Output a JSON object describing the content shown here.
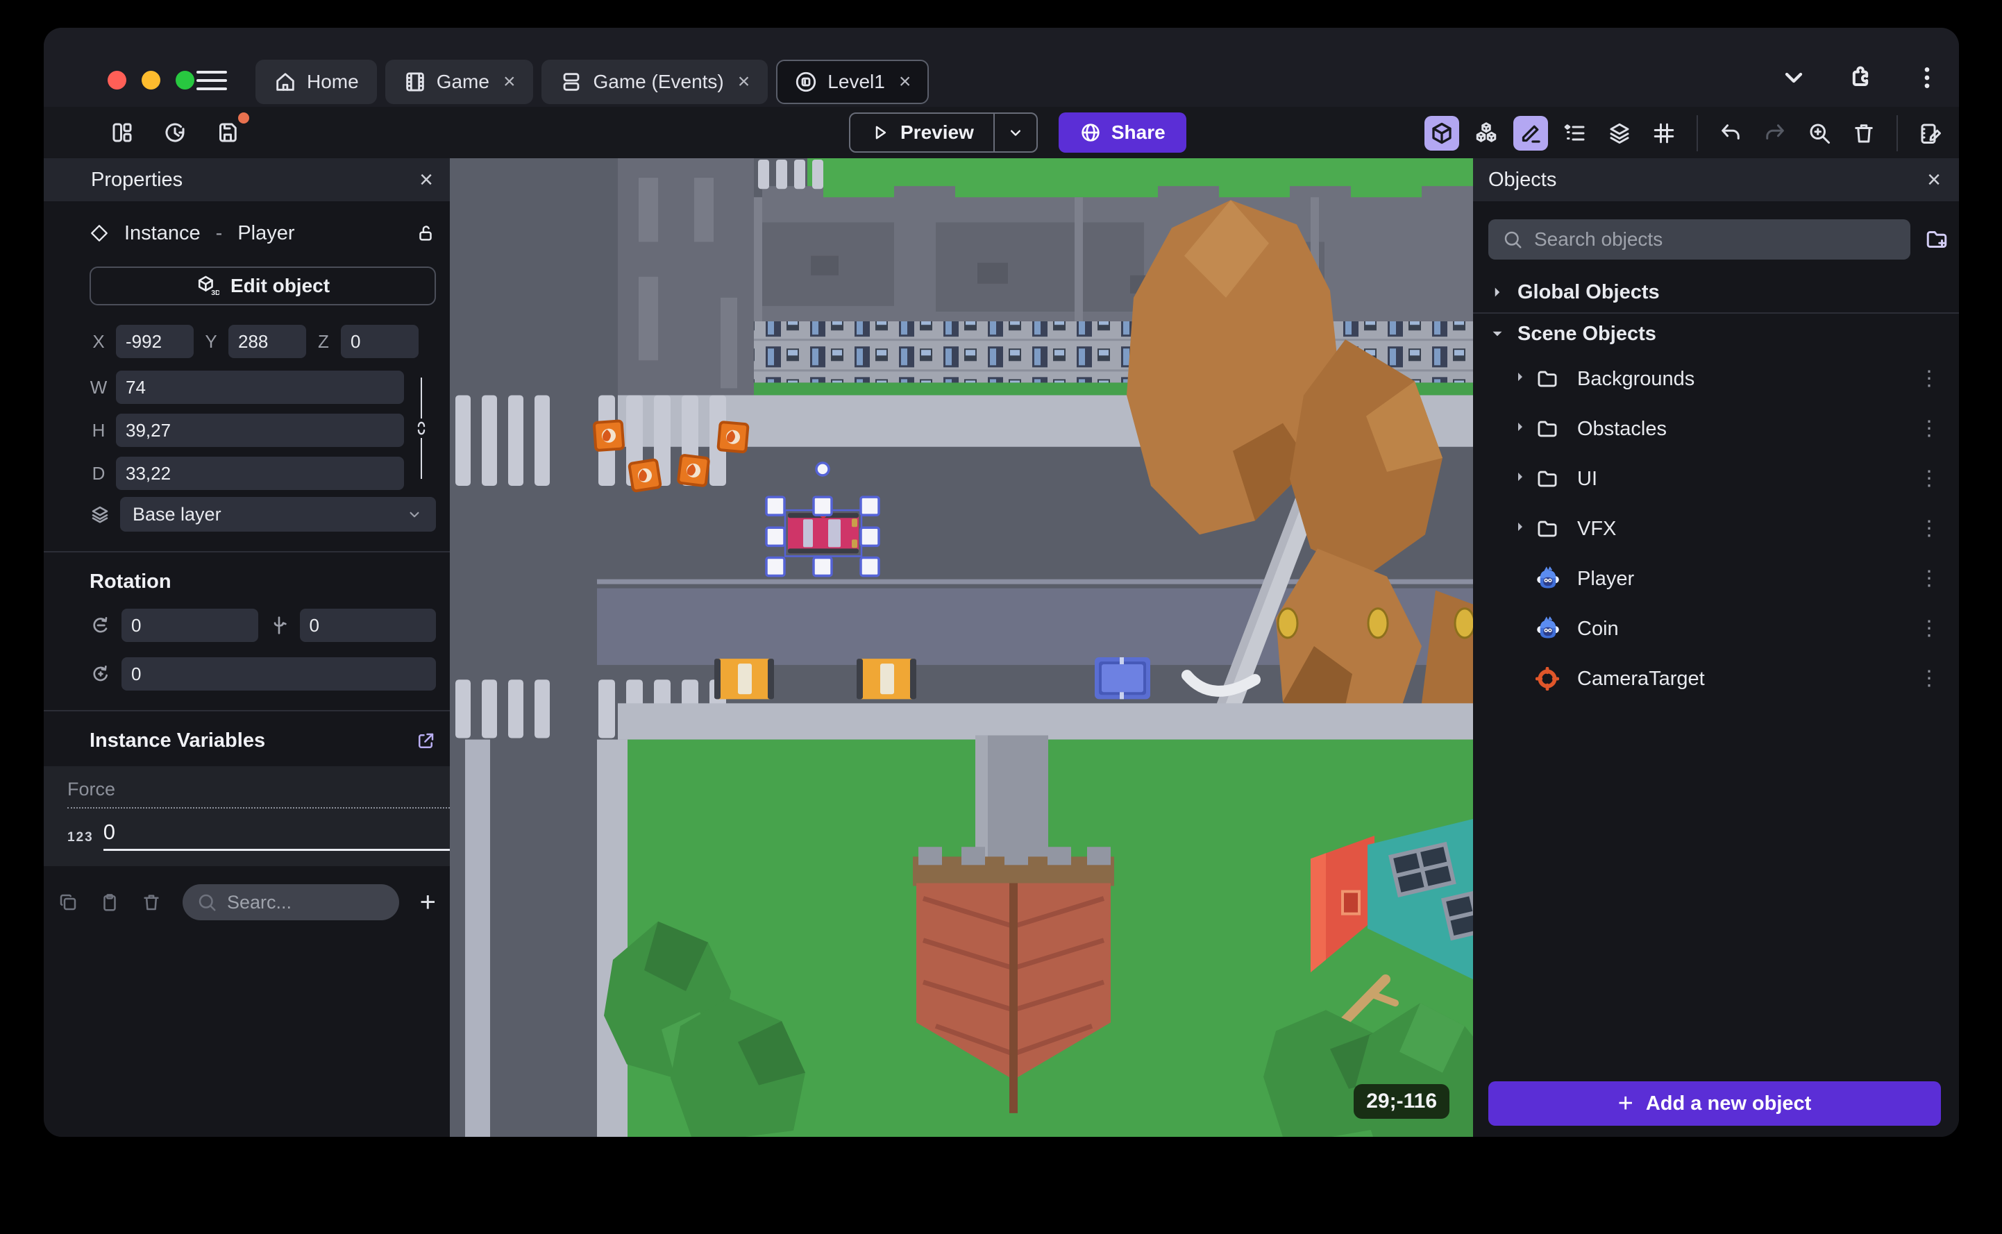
{
  "window": {
    "tabs": [
      {
        "label": "Home",
        "icon": "home-icon",
        "active": false,
        "closable": false
      },
      {
        "label": "Game",
        "icon": "film-icon",
        "active": false,
        "closable": true
      },
      {
        "label": "Game (Events)",
        "icon": "events-icon",
        "active": false,
        "closable": true
      },
      {
        "label": "Level1",
        "icon": "scene-icon",
        "active": true,
        "closable": true
      }
    ],
    "close_symbol": "×",
    "kebab_symbol": "⋮"
  },
  "toolbar": {
    "preview_label": "Preview",
    "share_label": "Share"
  },
  "properties_panel": {
    "title": "Properties",
    "instance_type": "Instance",
    "separator": "-",
    "object_name": "Player",
    "edit_object_label": "Edit object",
    "position": {
      "x_label": "X",
      "x_value": "-992",
      "y_label": "Y",
      "y_value": "288",
      "z_label": "Z",
      "z_value": "0"
    },
    "size": {
      "w_label": "W",
      "w_value": "74",
      "h_label": "H",
      "h_value": "39,27",
      "d_label": "D",
      "d_value": "33,22"
    },
    "layer_value": "Base layer",
    "rotation_title": "Rotation",
    "rotation_x": "0",
    "rotation_y": "0",
    "rotation_z": "0",
    "variables_title": "Instance Variables",
    "variable_name": "Force",
    "variable_type": "123",
    "variable_value": "0",
    "variables_search_placeholder": "Searc..."
  },
  "objects_panel": {
    "title": "Objects",
    "search_placeholder": "Search objects",
    "global_section": "Global Objects",
    "scene_section": "Scene Objects",
    "folders": [
      "Backgrounds",
      "Obstacles",
      "UI",
      "VFX"
    ],
    "objects": [
      {
        "name": "Player",
        "icon": "monkey-icon"
      },
      {
        "name": "Coin",
        "icon": "monkey-icon"
      },
      {
        "name": "CameraTarget",
        "icon": "target-icon"
      }
    ],
    "add_button_label": "Add a new object"
  },
  "scene": {
    "cursor_coordinates": "29;-116"
  },
  "colors": {
    "accent_purple": "#5b2ed6",
    "toolbar_toggle_active": "#b3a7f2",
    "save_badge_orange": "#e8714f",
    "selection_blue": "#5563d6",
    "traffic_red": "#ff5f57",
    "traffic_yellow": "#febc2e",
    "traffic_green": "#28c840"
  }
}
